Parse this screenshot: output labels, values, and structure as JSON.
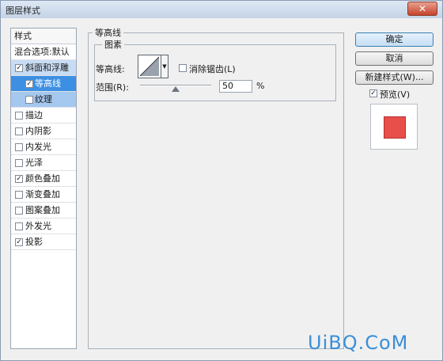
{
  "window": {
    "title": "图层样式",
    "close_glyph": "✕"
  },
  "styles": {
    "header": "样式",
    "blend_options": "混合选项:默认",
    "items": [
      {
        "label": "斜面和浮雕",
        "checked": "✓"
      },
      {
        "label": "等高线",
        "checked": "✓"
      },
      {
        "label": "纹理",
        "checked": ""
      },
      {
        "label": "描边",
        "checked": ""
      },
      {
        "label": "内阴影",
        "checked": ""
      },
      {
        "label": "内发光",
        "checked": ""
      },
      {
        "label": "光泽",
        "checked": ""
      },
      {
        "label": "颜色叠加",
        "checked": "✓"
      },
      {
        "label": "渐变叠加",
        "checked": ""
      },
      {
        "label": "图案叠加",
        "checked": ""
      },
      {
        "label": "外发光",
        "checked": ""
      },
      {
        "label": "投影",
        "checked": "✓"
      }
    ]
  },
  "contour": {
    "group_title": "等高线",
    "elements_title": "图素",
    "contour_label": "等高线:",
    "anti_alias_label": "消除锯齿(L)",
    "range_label": "范围(R):",
    "range_value": "50",
    "range_unit": "%",
    "range_fraction": 0.5
  },
  "buttons": {
    "ok": "确定",
    "cancel": "取消",
    "new_style": "新建样式(W)...",
    "preview_label": "预览(V)",
    "preview_checked": "✓"
  },
  "preview": {
    "swatch_color": "#e84e4a"
  },
  "watermark": "UiBQ.CoM"
}
